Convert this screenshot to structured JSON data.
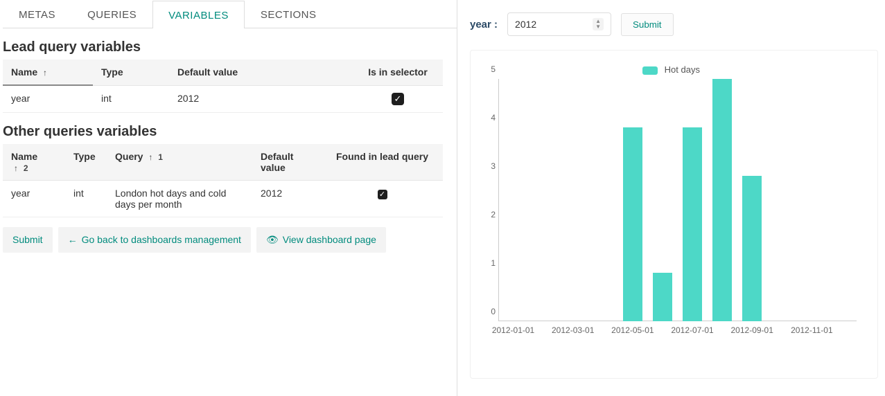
{
  "tabs": {
    "metas": "METAS",
    "queries": "QUERIES",
    "variables": "VARIABLES",
    "sections": "SECTIONS"
  },
  "lead": {
    "title": "Lead query variables",
    "headers": {
      "name": "Name",
      "type": "Type",
      "default": "Default value",
      "selector": "Is in selector"
    },
    "row": {
      "name": "year",
      "type": "int",
      "default": "2012",
      "selector": true
    }
  },
  "other": {
    "title": "Other queries variables",
    "headers": {
      "name": "Name",
      "type": "Type",
      "query": "Query",
      "default": "Default value",
      "found": "Found in lead query"
    },
    "sort": {
      "query_order": "1",
      "name_order": "2"
    },
    "row": {
      "name": "year",
      "type": "int",
      "query": "London hot days and cold days per month",
      "default": "2012",
      "found": true
    }
  },
  "buttons": {
    "submit": "Submit",
    "back": "Go back to dashboards management",
    "view": "View dashboard page"
  },
  "right": {
    "year_label": "year :",
    "year_value": "2012",
    "submit": "Submit"
  },
  "chart_data": {
    "type": "bar",
    "title": "",
    "legend": "Hot days",
    "ylim": [
      0,
      5
    ],
    "yticks": [
      0,
      1,
      2,
      3,
      4,
      5
    ],
    "xticks_shown": [
      "2012-01-01",
      "2012-03-01",
      "2012-05-01",
      "2012-07-01",
      "2012-09-01",
      "2012-11-01"
    ],
    "categories": [
      "2012-01-01",
      "2012-02-01",
      "2012-03-01",
      "2012-04-01",
      "2012-05-01",
      "2012-06-01",
      "2012-07-01",
      "2012-08-01",
      "2012-09-01",
      "2012-10-01",
      "2012-11-01",
      "2012-12-01"
    ],
    "values": [
      0,
      0,
      0,
      0,
      4,
      1,
      4,
      5,
      3,
      0,
      0,
      0
    ],
    "xlabel": "",
    "ylabel": ""
  }
}
